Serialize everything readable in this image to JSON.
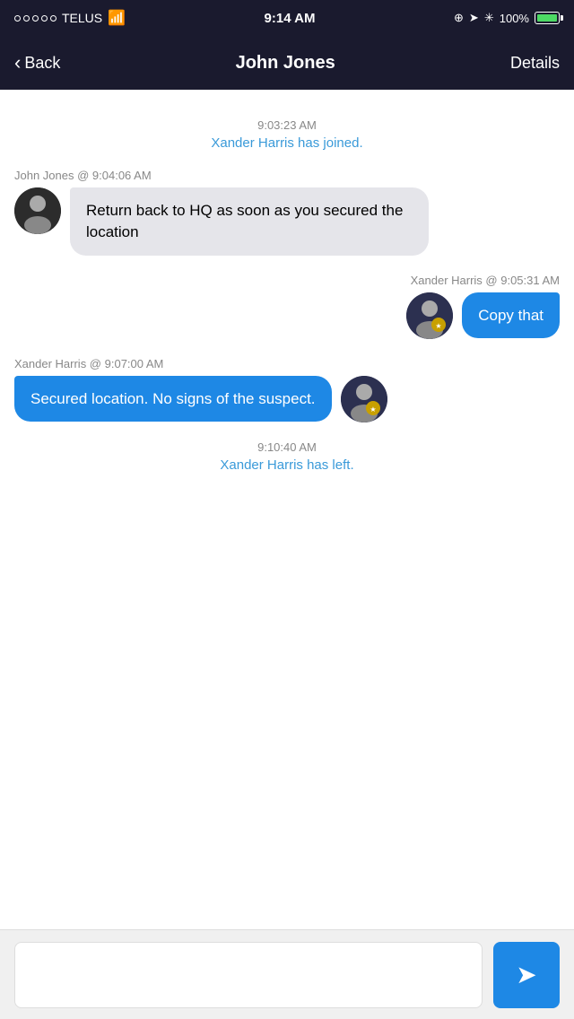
{
  "statusBar": {
    "carrier": "TELUS",
    "time": "9:14 AM",
    "battery": "100%"
  },
  "navBar": {
    "back_label": "Back",
    "title": "John Jones",
    "details_label": "Details"
  },
  "chat": {
    "messages": [
      {
        "type": "system",
        "time": "9:03:23 AM",
        "text": "Xander Harris has joined."
      },
      {
        "type": "incoming",
        "sender": "John Jones",
        "time": "9:04:06 AM",
        "text": "Return back to HQ as soon as you secured the location"
      },
      {
        "type": "outgoing",
        "sender": "Xander Harris",
        "time": "9:05:31 AM",
        "text": "Copy that"
      },
      {
        "type": "outgoing-left",
        "sender": "Xander Harris",
        "time": "9:07:00 AM",
        "text": "Secured location. No signs of the suspect."
      },
      {
        "type": "system",
        "time": "9:10:40 AM",
        "text": "Xander Harris has left."
      }
    ]
  },
  "inputArea": {
    "placeholder": "",
    "send_label": "➤"
  }
}
